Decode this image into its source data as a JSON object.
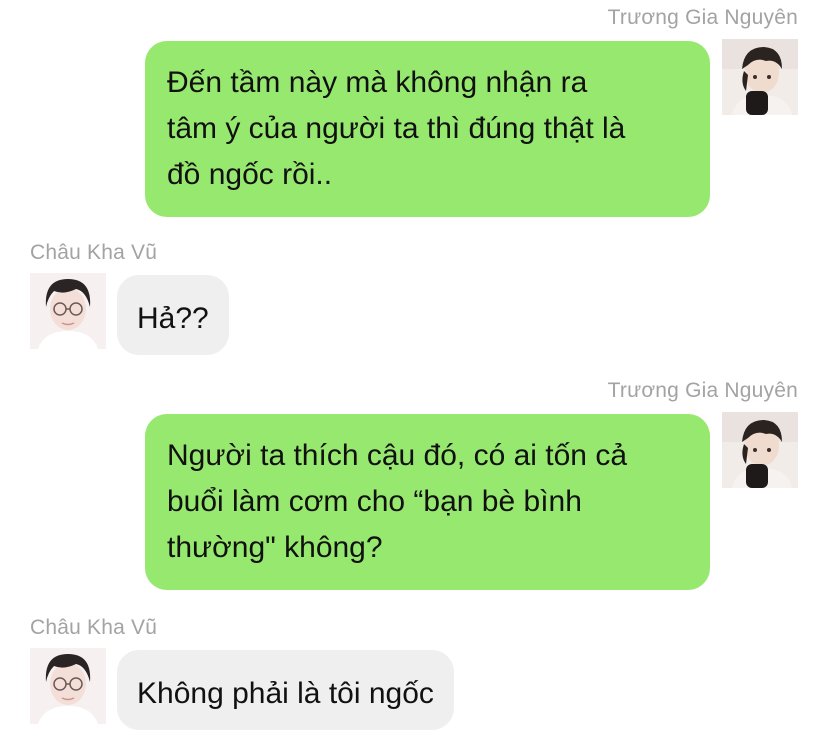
{
  "messages": [
    {
      "side": "me",
      "sender": "Trương Gia Nguyên",
      "lines": [
        "Đến tầm này mà không nhận ra",
        "tâm ý của người ta thì đúng thật là",
        "đồ ngốc rồi.."
      ]
    },
    {
      "side": "them",
      "sender": "Châu Kha Vũ",
      "lines": [
        "Hả??"
      ]
    },
    {
      "side": "me",
      "sender": "Trương Gia Nguyên",
      "lines": [
        "Người ta thích cậu đó, có ai tốn cả",
        "buổi làm cơm cho “bạn bè bình",
        "thường\" không?"
      ]
    },
    {
      "side": "them",
      "sender": "Châu Kha Vũ",
      "lines": [
        "Không phải là tôi ngốc"
      ]
    }
  ],
  "colors": {
    "my_bubble": "#96e86e",
    "their_bubble": "#efefef",
    "sender_name": "#a3a3a3"
  },
  "icons": {
    "my_avatar": "avatar-truong-gia-nguyen",
    "their_avatar": "avatar-chau-kha-vu"
  }
}
